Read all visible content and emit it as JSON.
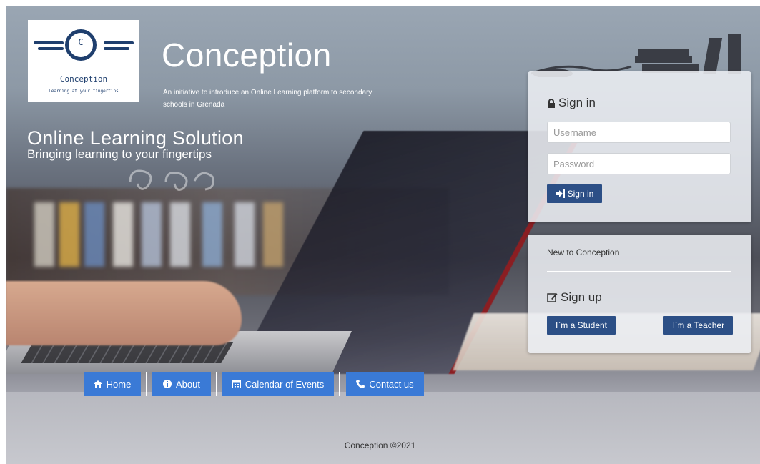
{
  "brand": {
    "logo_letter": "C",
    "logo_name": "Conception",
    "logo_tagline": "Learning at your fingertips",
    "title": "Conception",
    "subtitle": "An initiative to introduce an Online Learning platform to secondary schools in Grenada"
  },
  "hero": {
    "title": "Online Learning Solution",
    "subtitle": "Bringing learning to your fingertips"
  },
  "signin": {
    "heading": "Sign in",
    "heading_icon": "lock-icon",
    "username_placeholder": "Username",
    "username_value": "",
    "password_placeholder": "Password",
    "password_value": "",
    "button_label": "Sign in",
    "button_icon": "sign-in-icon"
  },
  "signup": {
    "new_label": "New to Conception",
    "heading": "Sign up",
    "heading_icon": "edit-icon",
    "student_label": "I`m a Student",
    "teacher_label": "I`m a Teacher"
  },
  "nav": {
    "items": [
      {
        "label": "Home",
        "icon": "home-icon"
      },
      {
        "label": "About",
        "icon": "info-icon"
      },
      {
        "label": "Calendar of Events",
        "icon": "calendar-icon"
      },
      {
        "label": "Contact us",
        "icon": "phone-icon"
      }
    ]
  },
  "footer": {
    "text": "Conception ©2021"
  },
  "colors": {
    "primary_button": "#2c4f86",
    "nav_button": "#3a7ad6",
    "logo_blue": "#1f3f6e",
    "panel": "#eceef2"
  }
}
